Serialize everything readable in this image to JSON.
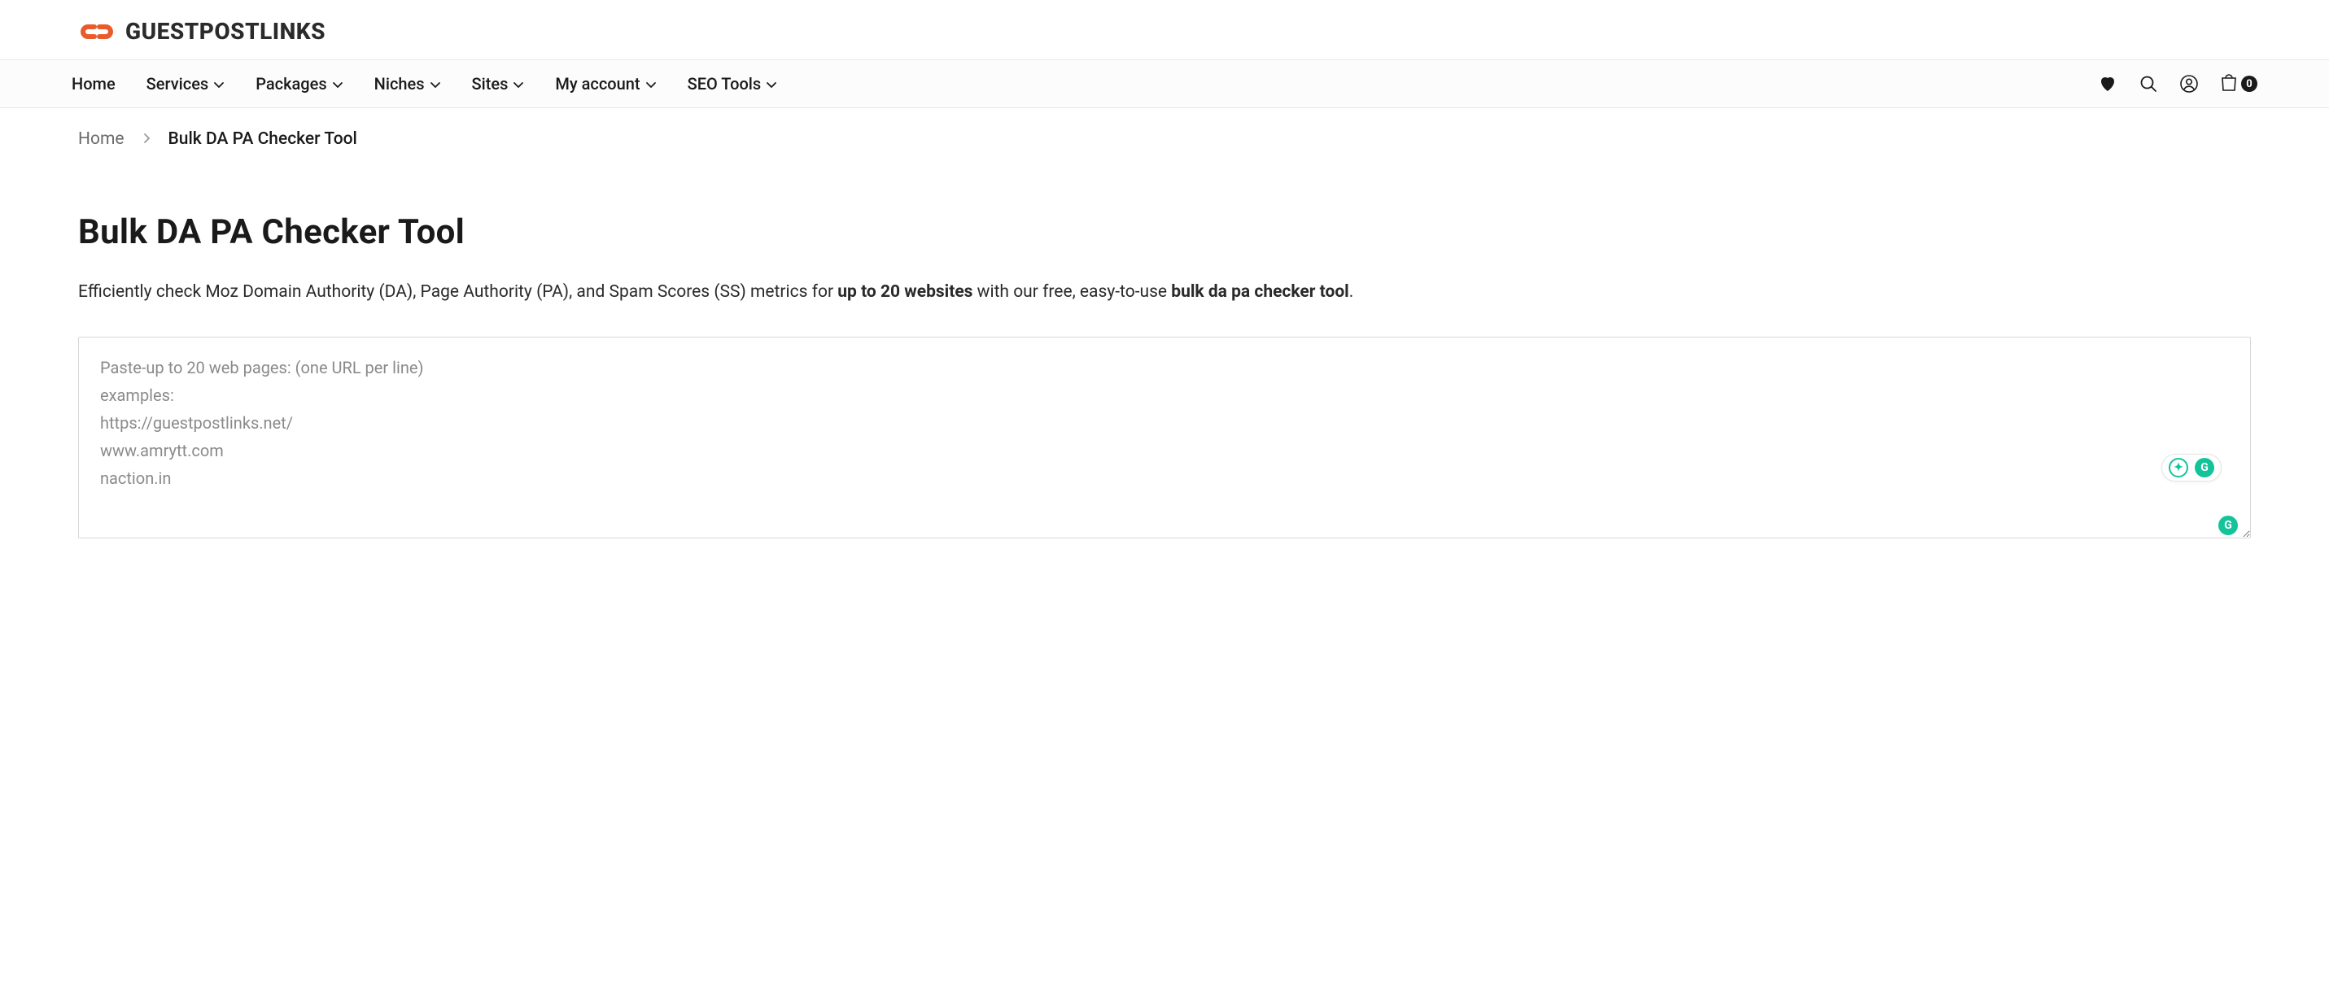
{
  "brand": {
    "name": "GUESTPOSTLINKS"
  },
  "nav": {
    "items": [
      {
        "label": "Home",
        "has_dropdown": false
      },
      {
        "label": "Services",
        "has_dropdown": true
      },
      {
        "label": "Packages",
        "has_dropdown": true
      },
      {
        "label": "Niches",
        "has_dropdown": true
      },
      {
        "label": "Sites",
        "has_dropdown": true
      },
      {
        "label": "My account",
        "has_dropdown": true
      },
      {
        "label": "SEO Tools",
        "has_dropdown": true
      }
    ],
    "cart_count": "0"
  },
  "breadcrumb": {
    "home": "Home",
    "current": "Bulk DA PA Checker Tool"
  },
  "page": {
    "title": "Bulk DA PA Checker Tool",
    "intro_prefix": "Efficiently check Moz Domain Authority (DA), Page Authority (PA), and Spam Scores (SS) metrics for ",
    "intro_bold1": "up to 20 websites",
    "intro_mid": " with our free, easy-to-use ",
    "intro_bold2": "bulk da pa checker tool",
    "intro_suffix": "."
  },
  "input": {
    "placeholder": "Paste-up to 20 web pages: (one URL per line)\nexamples:\nhttps://guestpostlinks.net/\nwww.amrytt.com\nnaction.in",
    "value": ""
  },
  "grammarly": {
    "suggestion": "✦",
    "badge": "G"
  }
}
